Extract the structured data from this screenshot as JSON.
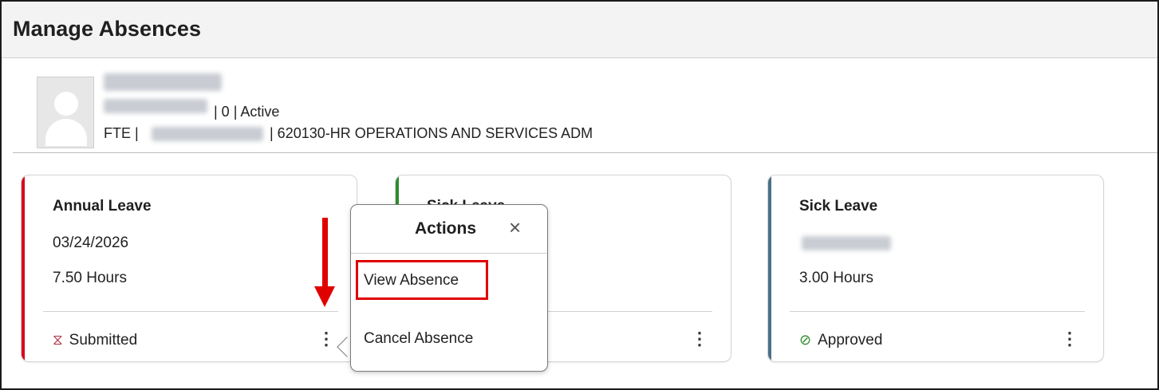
{
  "header": {
    "title": "Manage Absences"
  },
  "employee": {
    "status_suffix": "| 0 | Active",
    "line2_prefix": "FTE |",
    "department": "| 620130-HR OPERATIONS AND SERVICES ADM"
  },
  "cards": [
    {
      "title": "Annual Leave",
      "date": "03/24/2026",
      "hours": "7.50 Hours",
      "status": "Submitted",
      "status_icon": "hourglass-icon",
      "accent": "#d9001b"
    },
    {
      "title": "Sick Leave",
      "date": "",
      "hours": "",
      "status": "",
      "accent": "#2e8b2e"
    },
    {
      "title": "Sick Leave",
      "date": "",
      "hours": "3.00 Hours",
      "status": "Approved",
      "status_icon": "check-circle-icon",
      "accent": "#4a7088"
    }
  ],
  "popover": {
    "title": "Actions",
    "items": [
      "View Absence",
      "Cancel Absence"
    ],
    "highlight_color": "#e00000"
  }
}
